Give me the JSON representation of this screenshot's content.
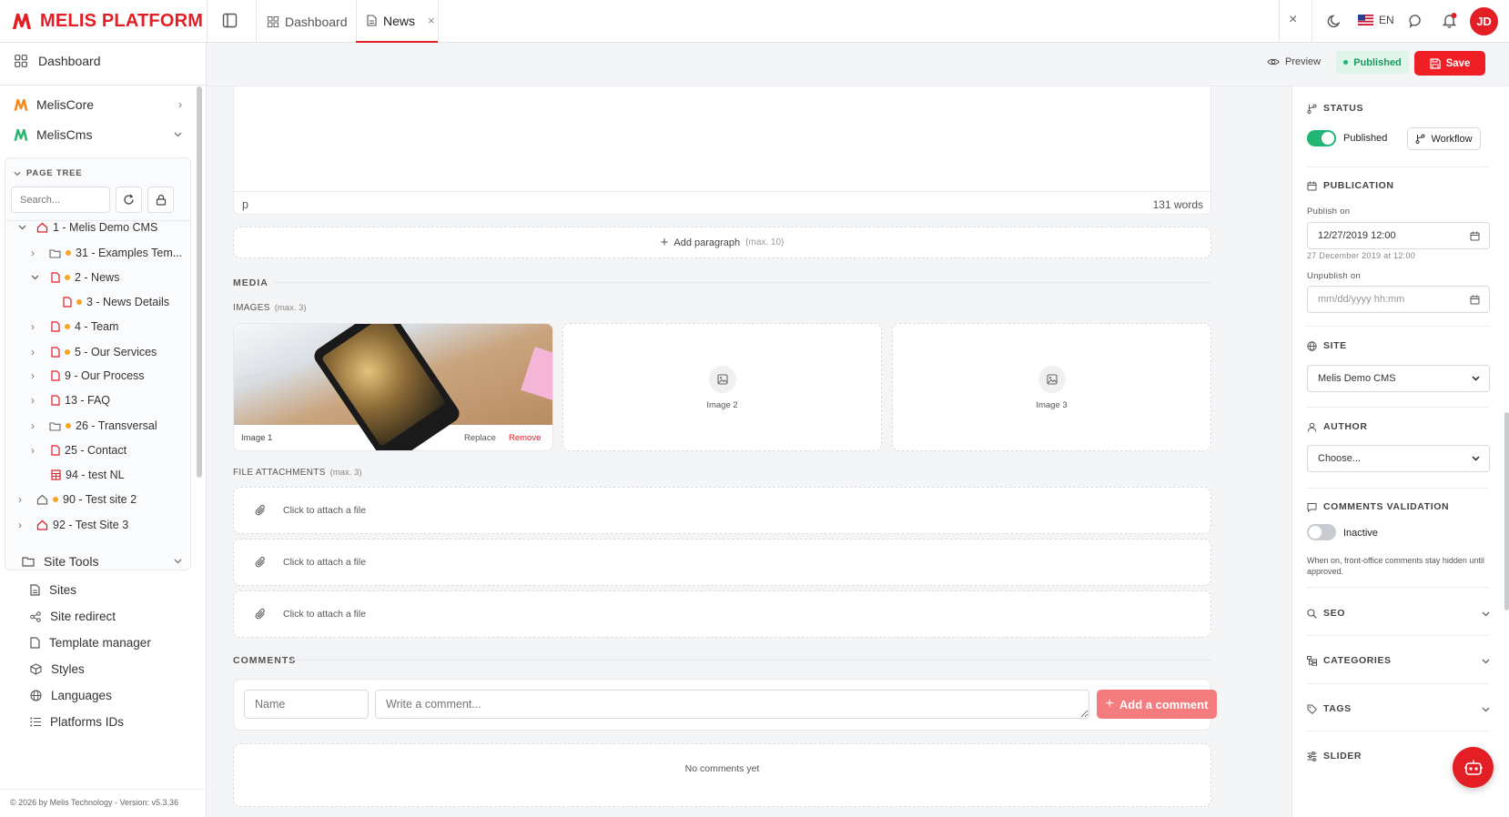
{
  "app": {
    "logo_text": "MELIS PLATFORM",
    "brand_color": "#e31e24"
  },
  "tabs": [
    {
      "label": "Dashboard"
    },
    {
      "label": "News",
      "close": "×"
    }
  ],
  "header_right": {
    "close": "×",
    "language": "EN",
    "avatar": "JD"
  },
  "sidebar": {
    "dashboard": "Dashboard",
    "modules": [
      {
        "label": "MelisCore"
      },
      {
        "label": "MelisCms"
      }
    ],
    "page_tree": {
      "title": "PAGE TREE",
      "search_placeholder": "Search...",
      "items": [
        {
          "label": "1 - Melis Demo CMS"
        },
        {
          "label": "31 - Examples Tem..."
        },
        {
          "label": "2 - News"
        },
        {
          "label": "3 - News Details"
        },
        {
          "label": "4 - Team"
        },
        {
          "label": "5 - Our Services"
        },
        {
          "label": "9 - Our Process"
        },
        {
          "label": "13 - FAQ"
        },
        {
          "label": "26 - Transversal"
        },
        {
          "label": "25 - Contact"
        },
        {
          "label": "94 - test NL"
        },
        {
          "label": "90 - Test site 2"
        },
        {
          "label": "92 - Test Site 3"
        }
      ]
    },
    "site_tools": {
      "title": "Site Tools",
      "items": [
        "Sites",
        "Site redirect",
        "Template manager",
        "Styles",
        "Languages",
        "Platforms IDs"
      ]
    },
    "footer": "© 2026 by Melis Technology - Version: v5.3.36"
  },
  "subbar": {
    "preview": "Preview",
    "published": "Published",
    "save": "Save"
  },
  "editor": {
    "tag": "p",
    "word_count": "131 words"
  },
  "add_paragraph": {
    "label": "Add paragraph",
    "hint": "(max. 10)"
  },
  "media": {
    "title": "MEDIA",
    "images_label": "IMAGES",
    "images_hint": "(max. 3)",
    "images": [
      {
        "label": "Image 1",
        "replace": "Replace",
        "remove": "Remove"
      },
      {
        "label": "Image 2"
      },
      {
        "label": "Image 3"
      }
    ],
    "attachments_label": "FILE ATTACHMENTS",
    "attachments_hint": "(max. 3)",
    "attachments": [
      "Click to attach a file",
      "Click to attach a file",
      "Click to attach a file"
    ]
  },
  "comments": {
    "title": "COMMENTS",
    "name_placeholder": "Name",
    "comment_placeholder": "Write a comment...",
    "add_button": "Add a comment",
    "empty": "No comments yet"
  },
  "right_panel": {
    "status": {
      "title": "STATUS",
      "toggle_label": "Published",
      "toggle_on": true,
      "workflow": "Workflow"
    },
    "publication": {
      "title": "PUBLICATION",
      "publish_label": "Publish on",
      "publish_value": "12/27/2019 12:00",
      "publish_hint": "27 December 2019 at 12:00",
      "unpublish_label": "Unpublish on",
      "unpublish_placeholder": "mm/dd/yyyy hh:mm"
    },
    "site": {
      "title": "SITE",
      "value": "Melis Demo CMS"
    },
    "author": {
      "title": "AUTHOR",
      "value": "Choose..."
    },
    "comments_validation": {
      "title": "COMMENTS VALIDATION",
      "toggle_label": "Inactive",
      "toggle_on": false,
      "hint": "When on, front-office comments stay hidden until approved."
    },
    "seo": {
      "title": "SEO"
    },
    "categories": {
      "title": "CATEGORIES"
    },
    "tags": {
      "title": "TAGS"
    },
    "slider": {
      "title": "SLIDER"
    }
  },
  "colors": {
    "accent": "#e31e24",
    "success": "#22b573",
    "save": "#f01e25"
  }
}
